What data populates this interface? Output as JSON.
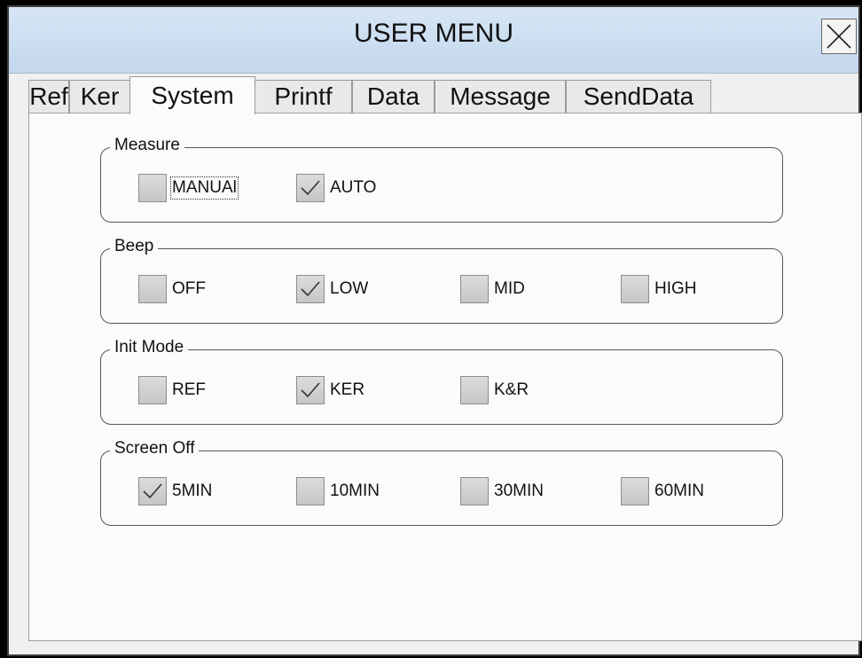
{
  "window": {
    "title": "USER MENU"
  },
  "tabs": [
    {
      "label": "Ref"
    },
    {
      "label": "Ker"
    },
    {
      "label": "System",
      "active": true
    },
    {
      "label": "Printf"
    },
    {
      "label": "Data"
    },
    {
      "label": "Message"
    },
    {
      "label": "SendData"
    }
  ],
  "groups": {
    "measure": {
      "label": "Measure",
      "options": [
        {
          "label": "MANUAl",
          "checked": false
        },
        {
          "label": "AUTO",
          "checked": true
        }
      ]
    },
    "beep": {
      "label": "Beep",
      "options": [
        {
          "label": "OFF",
          "checked": false
        },
        {
          "label": "LOW",
          "checked": true
        },
        {
          "label": "MID",
          "checked": false
        },
        {
          "label": "HIGH",
          "checked": false
        }
      ]
    },
    "init_mode": {
      "label": "Init Mode",
      "options": [
        {
          "label": "REF",
          "checked": false
        },
        {
          "label": "KER",
          "checked": true
        },
        {
          "label": "K&R",
          "checked": false
        }
      ]
    },
    "screen_off": {
      "label": "Screen Off",
      "options": [
        {
          "label": "5MIN",
          "checked": true
        },
        {
          "label": "10MIN",
          "checked": false
        },
        {
          "label": "30MIN",
          "checked": false
        },
        {
          "label": "60MIN",
          "checked": false
        }
      ]
    }
  },
  "icons": {
    "close": "close-icon",
    "check": "checkmark-icon"
  }
}
